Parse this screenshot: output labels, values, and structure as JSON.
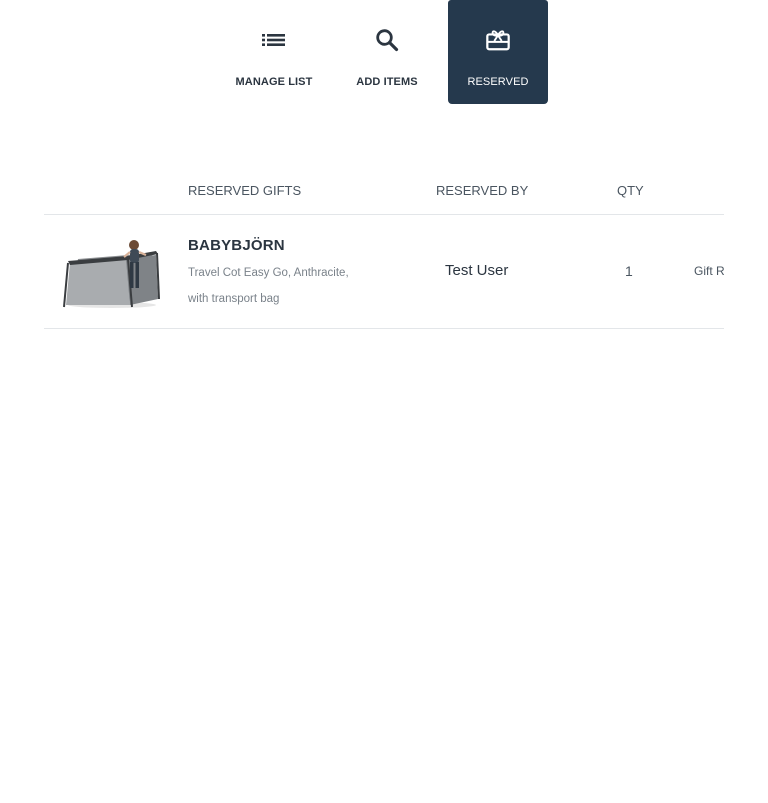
{
  "tabs": [
    {
      "label": "MANAGE LIST",
      "icon": "list-icon",
      "active": false
    },
    {
      "label": "ADD ITEMS",
      "icon": "search-icon",
      "active": false
    },
    {
      "label": "RESERVED",
      "icon": "gift-card-icon",
      "active": true
    }
  ],
  "table": {
    "headers": {
      "gifts": "RESERVED GIFTS",
      "reserved_by": "RESERVED BY",
      "qty": "QTY"
    },
    "rows": [
      {
        "image": "travel-cot-image",
        "brand": "BABYBJÖRN",
        "description": "Travel Cot Easy Go, Anthracite, with transport bag",
        "reserved_by": "Test User",
        "qty": "1",
        "action": "Gift R"
      }
    ]
  },
  "colors": {
    "active_tab_bg": "#25394d",
    "text": "#2b3540",
    "muted_text": "#7a828a",
    "divider": "#e3e6e9"
  }
}
